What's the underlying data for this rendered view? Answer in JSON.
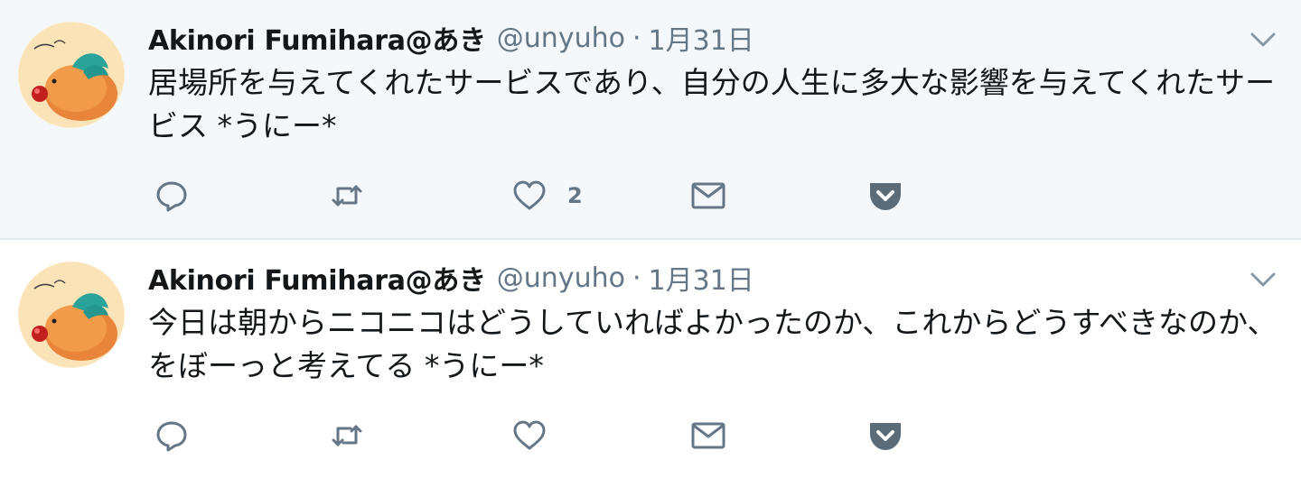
{
  "tweets": [
    {
      "fullname": "Akinori Fumihara@あき",
      "username": "@unyuho",
      "separator": "·",
      "time": "1月31日",
      "text": "居場所を与えてくれたサービスであり、自分の人生に多大な影響を与えてくれたサービス *うにー*",
      "like_count": "2"
    },
    {
      "fullname": "Akinori Fumihara@あき",
      "username": "@unyuho",
      "separator": "·",
      "time": "1月31日",
      "text": "今日は朝からニコニコはどうしていればよかったのか、これからどうすべきなのか、をぼーっと考えてる *うにー*",
      "like_count": ""
    }
  ],
  "icons": {
    "reply": "reply-icon",
    "retweet": "retweet-icon",
    "like": "heart-icon",
    "dm": "mail-icon",
    "pocket": "pocket-icon",
    "caret": "chevron-down-icon"
  },
  "colors": {
    "icon_gray": "#657786",
    "pocket_gray": "#5b6b78",
    "highlight_bg": "#f5f8fa",
    "divider": "#e6ecf0"
  }
}
